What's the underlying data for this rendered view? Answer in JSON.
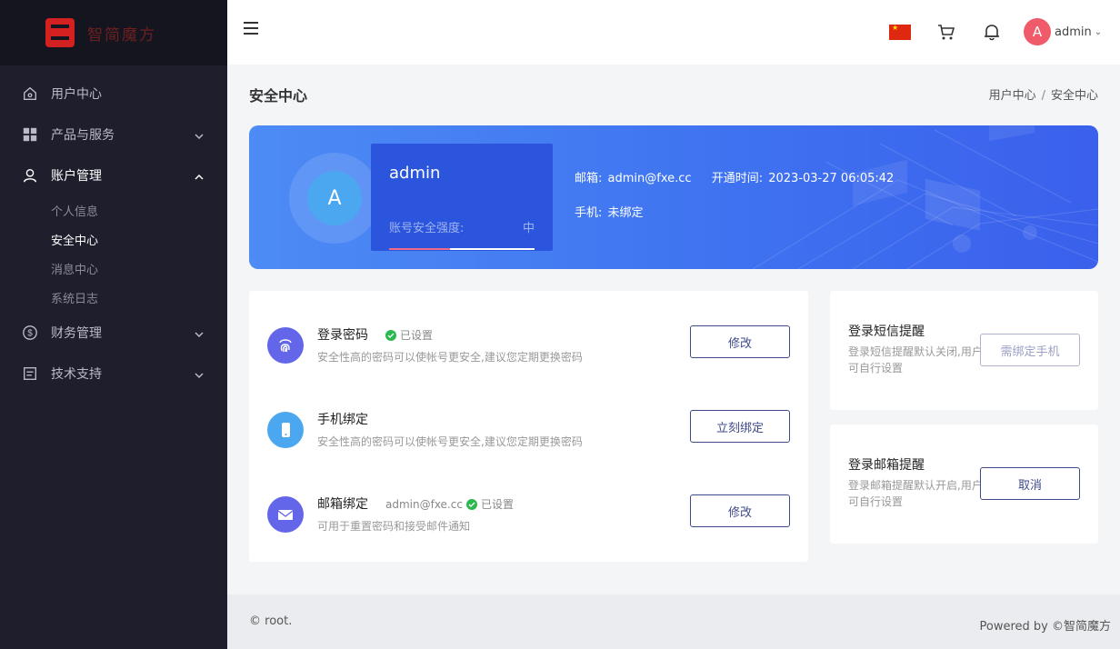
{
  "brand": {
    "logo_text": "智简魔方"
  },
  "sidebar": {
    "items": [
      {
        "label": "用户中心",
        "icon": "home-icon"
      },
      {
        "label": "产品与服务",
        "icon": "grid-icon"
      },
      {
        "label": "账户管理",
        "icon": "user-icon"
      },
      {
        "label": "财务管理",
        "icon": "dollar-icon"
      },
      {
        "label": "技术支持",
        "icon": "document-icon"
      }
    ],
    "account_sub": [
      "个人信息",
      "安全中心",
      "消息中心",
      "系统日志"
    ]
  },
  "header": {
    "user_initial": "A",
    "user_name": "admin",
    "caret": "⌄"
  },
  "page": {
    "title": "安全中心",
    "breadcrumb": [
      "用户中心",
      "/",
      "安全中心"
    ]
  },
  "banner": {
    "initial": "A",
    "name": "admin",
    "security_label": "账号安全强度:",
    "security_level": "中",
    "security_fraction": 0.42,
    "email_label": "邮箱:",
    "email": "admin@fxe.cc",
    "since_label": "开通时间:",
    "since": "2023-03-27 06:05:42",
    "phone_label": "手机:",
    "phone": "未绑定"
  },
  "security": {
    "password": {
      "title": "登录密码",
      "status": "已设置",
      "desc": "安全性高的密码可以使帐号更安全,建议您定期更换密码",
      "button": "修改"
    },
    "phone": {
      "title": "手机绑定",
      "desc": "安全性高的密码可以使帐号更安全,建议您定期更换密码",
      "button": "立刻绑定"
    },
    "email": {
      "title": "邮箱绑定",
      "address": "admin@fxe.cc",
      "status": "已设置",
      "desc": "可用于重置密码和接受邮件通知",
      "button": "修改"
    }
  },
  "alerts": {
    "sms": {
      "title": "登录短信提醒",
      "desc": "登录短信提醒默认关闭,用户可自行设置",
      "button": "需绑定手机"
    },
    "email": {
      "title": "登录邮箱提醒",
      "desc": "登录邮箱提醒默认开启,用户可自行设置",
      "button": "取消"
    }
  },
  "footer": {
    "left": "© root.",
    "right": "Powered by ©智简魔方"
  },
  "colors": {
    "sidebar": "#1e1e2d",
    "banner": "#4177f2",
    "accent": "#3f4a8a",
    "success": "#2bb84e",
    "avatar": "#ef5b6a"
  }
}
